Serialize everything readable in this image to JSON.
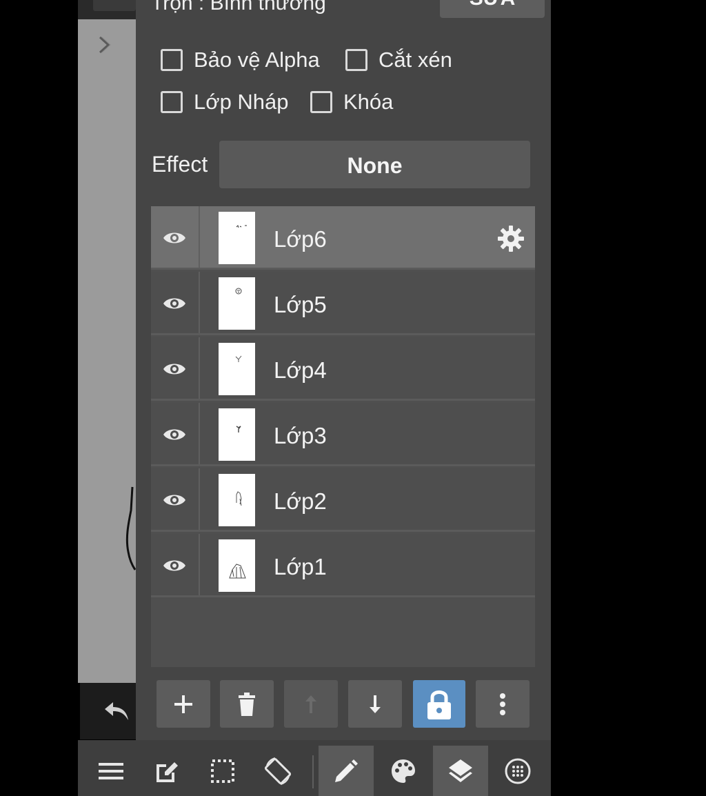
{
  "panel": {
    "blend_label": "Trộn : Bình thường",
    "edit_button": "SỬA",
    "checkboxes": [
      {
        "label": "Bảo vệ Alpha",
        "checked": false
      },
      {
        "label": "Cắt xén",
        "checked": false
      },
      {
        "label": "Lớp Nháp",
        "checked": false
      },
      {
        "label": "Khóa",
        "checked": false
      }
    ],
    "effect_label": "Effect",
    "effect_value": "None"
  },
  "layers": [
    {
      "name": "Lớp6",
      "selected": true,
      "visible": true
    },
    {
      "name": "Lớp5",
      "selected": false,
      "visible": true
    },
    {
      "name": "Lớp4",
      "selected": false,
      "visible": true
    },
    {
      "name": "Lớp3",
      "selected": false,
      "visible": true
    },
    {
      "name": "Lớp2",
      "selected": false,
      "visible": true
    },
    {
      "name": "Lớp1",
      "selected": false,
      "visible": true
    }
  ],
  "layer_tools": [
    {
      "icon": "plus-icon",
      "state": "enabled"
    },
    {
      "icon": "trash-icon",
      "state": "enabled"
    },
    {
      "icon": "arrow-up-icon",
      "state": "disabled"
    },
    {
      "icon": "arrow-down-icon",
      "state": "enabled"
    },
    {
      "icon": "lock-icon",
      "state": "active"
    },
    {
      "icon": "more-vertical-icon",
      "state": "enabled"
    }
  ],
  "bottom_bar": [
    {
      "icon": "menu-icon",
      "active": false
    },
    {
      "icon": "edit-square-icon",
      "active": false
    },
    {
      "icon": "selection-icon",
      "active": false
    },
    {
      "icon": "rotate-screen-icon",
      "active": false
    },
    {
      "icon": "pen-icon",
      "active": true
    },
    {
      "icon": "palette-icon",
      "active": false
    },
    {
      "icon": "layers-icon",
      "active": true
    },
    {
      "icon": "grid-circle-icon",
      "active": false
    }
  ],
  "colors": {
    "panel_bg": "#454545",
    "selected_row": "#707070",
    "accent_blue": "#5b8fc2",
    "canvas_gray": "#9b9b9b"
  }
}
